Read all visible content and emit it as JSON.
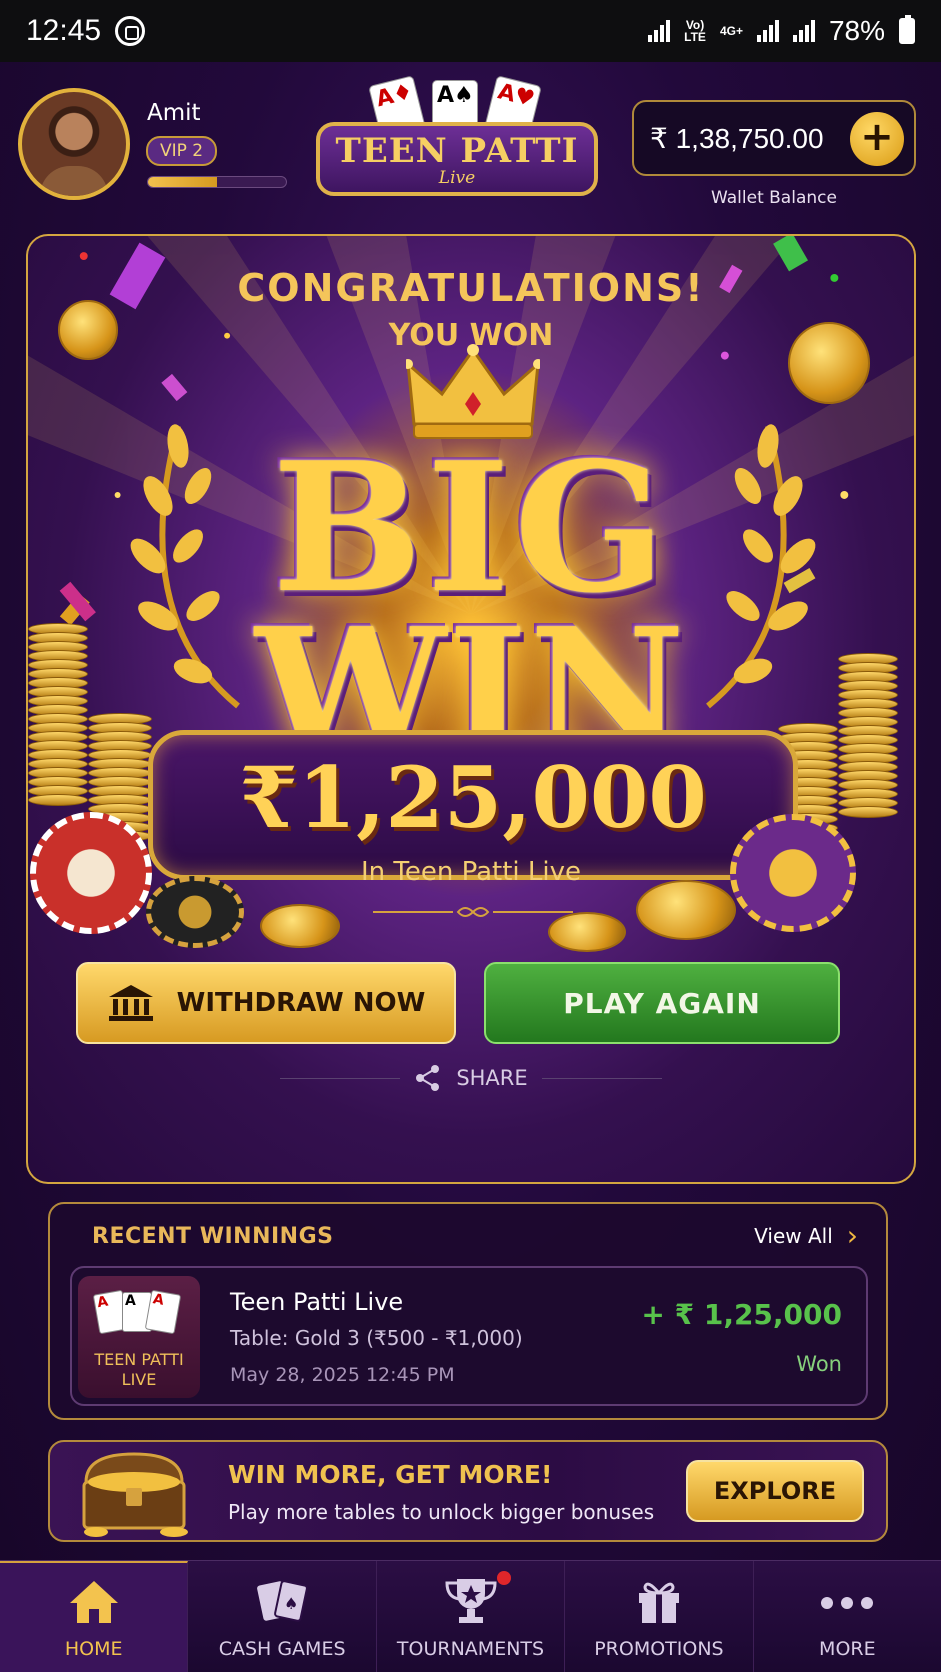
{
  "status_bar": {
    "time": "12:45",
    "network_label_1": "Vo)",
    "network_label_2": "LTE",
    "network_label_3": "4G+",
    "battery": "78%"
  },
  "user": {
    "name": "Amit",
    "vip_level": "VIP 2",
    "vip_progress": 0.5
  },
  "logo": {
    "title": "TEEN PATTI",
    "subtitle": "Live"
  },
  "wallet": {
    "balance": "₹ 1,38,750.00",
    "add_symbol": "+",
    "label": "Wallet Balance"
  },
  "win": {
    "congrats": "CONGRATULATIONS!",
    "you_won": "YOU WON",
    "big": "BIG",
    "win": "WIN",
    "amount": "₹1,25,000",
    "game": "In Teen Patti Live",
    "withdraw_label": "WITHDRAW NOW",
    "play_again_label": "PLAY AGAIN",
    "share_label": "SHARE"
  },
  "recent": {
    "title": "RECENT WINNINGS",
    "view_all": "View All",
    "items": [
      {
        "thumb_label_1": "TEEN PATTI",
        "thumb_label_2": "LIVE",
        "name": "Teen Patti Live",
        "table": "Table: Gold 3 (₹500 - ₹1,000)",
        "date": "May 28, 2025 12:45 PM",
        "amount": "+ ₹ 1,25,000",
        "status": "Won"
      }
    ]
  },
  "promo": {
    "title": "WIN MORE, GET MORE!",
    "subtitle": "Play more tables to unlock bigger bonuses",
    "button": "EXPLORE"
  },
  "nav": {
    "items": [
      {
        "label": "HOME",
        "icon": "home-icon",
        "active": true
      },
      {
        "label": "CASH GAMES",
        "icon": "cards-icon"
      },
      {
        "label": "TOURNAMENTS",
        "icon": "trophy-icon",
        "badge": true
      },
      {
        "label": "PROMOTIONS",
        "icon": "gift-icon"
      },
      {
        "label": "MORE",
        "icon": "more-icon"
      }
    ]
  },
  "colors": {
    "accent_gold": "#f0c24f",
    "play_green": "#23781e",
    "win_green": "#58c24b",
    "background": "#22093b"
  }
}
